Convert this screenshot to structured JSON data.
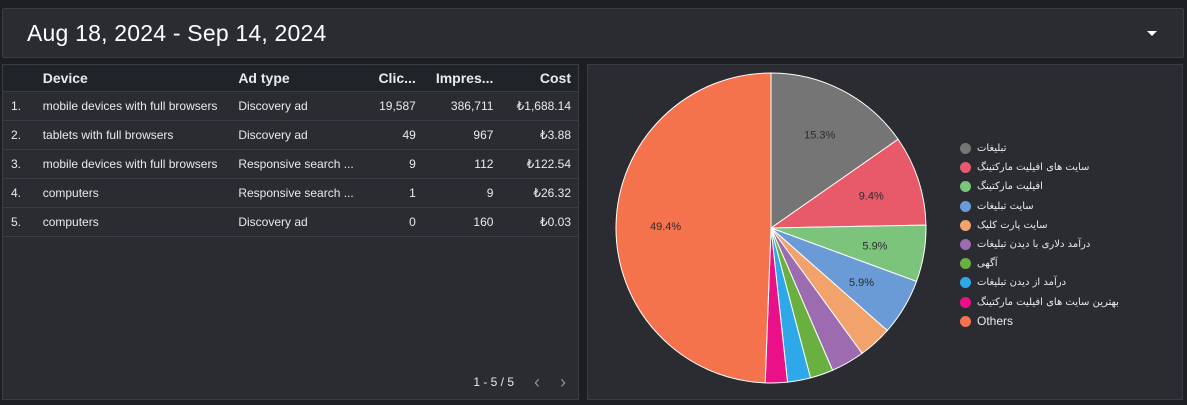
{
  "date_range": {
    "label": "Aug 18, 2024 - Sep 14, 2024"
  },
  "table": {
    "headers": {
      "device": "Device",
      "ad_type": "Ad type",
      "clicks": "Clic...",
      "impressions": "Impres...",
      "cost": "Cost"
    },
    "rows": [
      {
        "idx": "1.",
        "device": "mobile devices with full browsers",
        "ad_type": "Discovery ad",
        "clicks": "19,587",
        "impressions": "386,711",
        "cost": "₺1,688.14"
      },
      {
        "idx": "2.",
        "device": "tablets with full browsers",
        "ad_type": "Discovery ad",
        "clicks": "49",
        "impressions": "967",
        "cost": "₺3.88"
      },
      {
        "idx": "3.",
        "device": "mobile devices with full browsers",
        "ad_type": "Responsive search ...",
        "clicks": "9",
        "impressions": "112",
        "cost": "₺122.54"
      },
      {
        "idx": "4.",
        "device": "computers",
        "ad_type": "Responsive search ...",
        "clicks": "1",
        "impressions": "9",
        "cost": "₺26.32"
      },
      {
        "idx": "5.",
        "device": "computers",
        "ad_type": "Discovery ad",
        "clicks": "0",
        "impressions": "160",
        "cost": "₺0.03"
      }
    ],
    "pagination": {
      "label": "1 - 5 / 5"
    }
  },
  "chart_data": {
    "type": "pie",
    "series": [
      {
        "name": "تبلیغات",
        "value": 15.3,
        "label": "15.3%",
        "color": "#757575"
      },
      {
        "name": "سایت های افیلیت مارکتینگ",
        "value": 9.4,
        "label": "9.4%",
        "color": "#e8596a"
      },
      {
        "name": "افیلیت مارکتینگ",
        "value": 5.9,
        "label": "5.9%",
        "color": "#7cc47c"
      },
      {
        "name": "سایت تبلیغات",
        "value": 5.9,
        "label": "5.9%",
        "color": "#6a9bd6"
      },
      {
        "name": "سایت پارت کلیک",
        "value": 3.5,
        "label": "",
        "color": "#f2a36b"
      },
      {
        "name": "درآمد دلاری با دیدن تبلیغات",
        "value": 3.5,
        "label": "",
        "color": "#9c6bb0"
      },
      {
        "name": "آگهی",
        "value": 2.4,
        "label": "",
        "color": "#69b040"
      },
      {
        "name": "درآمد از دیدن تبلیغات",
        "value": 2.4,
        "label": "",
        "color": "#2ea8e8"
      },
      {
        "name": "بهترین سایت های افیلیت مارکتینگ",
        "value": 2.3,
        "label": "",
        "color": "#ea1188"
      },
      {
        "name": "Others",
        "value": 49.4,
        "label": "49.4%",
        "color": "#f4734d"
      }
    ]
  }
}
